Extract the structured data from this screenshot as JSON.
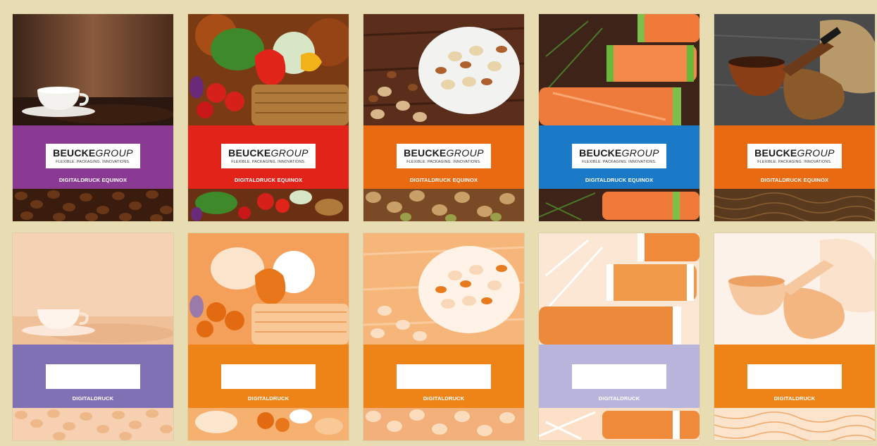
{
  "logo": {
    "brand_bold": "BEUCKE",
    "brand_light": "GROUP",
    "tagline": "FLEXIBLE. PACKAGING. INNOVATIONS."
  },
  "top_row": [
    {
      "theme": "coffee",
      "band_color": "#8a3a92",
      "label": "DIGITALDRUCK EQUINOX"
    },
    {
      "theme": "vegetables",
      "band_color": "#e2231a",
      "label": "DIGITALDRUCK EQUINOX"
    },
    {
      "theme": "nuts",
      "band_color": "#ea6a12",
      "label": "DIGITALDRUCK EQUINOX"
    },
    {
      "theme": "salmon",
      "band_color": "#1a7ac8",
      "label": "DIGITALDRUCK EQUINOX"
    },
    {
      "theme": "tobacco",
      "band_color": "#ea6a12",
      "label": "DIGITALDRUCK EQUINOX"
    }
  ],
  "bottom_row": [
    {
      "theme": "coffee",
      "band_color": "#8070b4",
      "label": "DIGITALDRUCK"
    },
    {
      "theme": "vegetables",
      "band_color": "#ee8418",
      "label": "DIGITALDRUCK"
    },
    {
      "theme": "nuts",
      "band_color": "#ee8418",
      "label": "DIGITALDRUCK"
    },
    {
      "theme": "salmon",
      "band_color": "#b8b4dc",
      "label": "DIGITALDRUCK"
    },
    {
      "theme": "tobacco",
      "band_color": "#ee8418",
      "label": "DIGITALDRUCK"
    }
  ]
}
